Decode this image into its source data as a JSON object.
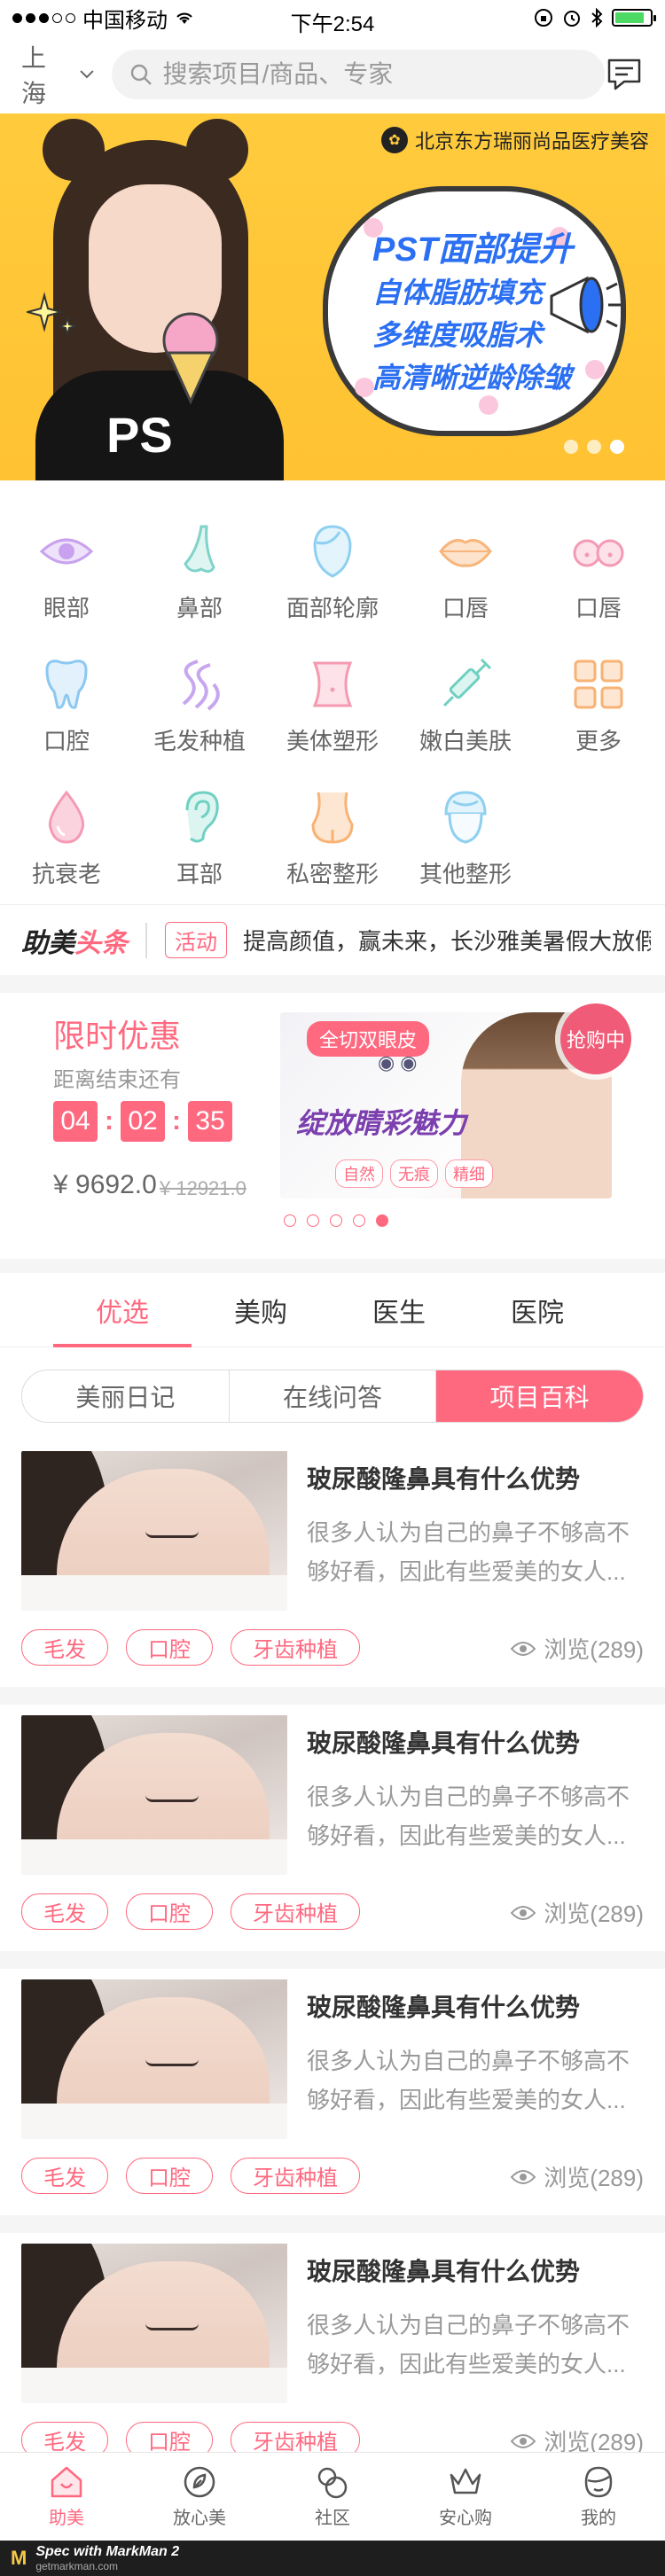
{
  "status": {
    "carrier": "中国移动",
    "time": "下午2:54"
  },
  "header": {
    "city": "上海",
    "search_placeholder": "搜索项目/商品、专家"
  },
  "banner": {
    "brand": "北京东方瑞丽尚品医疗美容",
    "lines": [
      "PST面部提升",
      "自体脂肪填充",
      "多维度吸脂术",
      "高清晰逆龄除皱"
    ],
    "shirt_text": "PS"
  },
  "categories": [
    {
      "label": "眼部",
      "icon": "eye-icon",
      "color": "#c9a2ef"
    },
    {
      "label": "鼻部",
      "icon": "nose-icon",
      "color": "#7fd3c8"
    },
    {
      "label": "面部轮廓",
      "icon": "face-contour-icon",
      "color": "#8fd0f0"
    },
    {
      "label": "口唇",
      "icon": "lips-icon",
      "color": "#f7b57a"
    },
    {
      "label": "口唇",
      "icon": "chest-icon",
      "color": "#f49ab5"
    },
    {
      "label": "口腔",
      "icon": "tooth-icon",
      "color": "#8cc8f2"
    },
    {
      "label": "毛发种植",
      "icon": "hair-icon",
      "color": "#c7a6ef"
    },
    {
      "label": "美体塑形",
      "icon": "body-shape-icon",
      "color": "#f59ab0"
    },
    {
      "label": "嫩白美肤",
      "icon": "syringe-icon",
      "color": "#6fd0c2"
    },
    {
      "label": "更多",
      "icon": "grid-more-icon",
      "color": "#f8b274"
    },
    {
      "label": "抗衰老",
      "icon": "drop-icon",
      "color": "#f49ab5"
    },
    {
      "label": "耳部",
      "icon": "ear-icon",
      "color": "#6fd0c2"
    },
    {
      "label": "私密整形",
      "icon": "hip-icon",
      "color": "#f8b274"
    },
    {
      "label": "其他整形",
      "icon": "towel-head-icon",
      "color": "#8fd0f0"
    }
  ],
  "news": {
    "title_a": "助美",
    "title_b": "头条",
    "tag": "活动",
    "text": "提高颜值，赢未来，长沙雅美暑假大放假大"
  },
  "flash": {
    "title": "限时优惠",
    "subtitle": "距离结束还有",
    "hours": "04",
    "minutes": "02",
    "seconds": "35",
    "price": "¥ 9692.0",
    "old_price": "¥ 12921.0",
    "buy_label": "抢购中",
    "promo_tag": "全切双眼皮",
    "promo_big": "绽放睛彩魅力",
    "promo_chips": [
      "自然",
      "无痕",
      "精细"
    ]
  },
  "main_tabs": [
    "优选",
    "美购",
    "医生",
    "医院"
  ],
  "segments": [
    "美丽日记",
    "在线问答",
    "项目百科"
  ],
  "articles": [
    {
      "title": "玻尿酸隆鼻具有什么优势",
      "desc": "很多人认为自己的鼻子不够高不够好看，因此有些爱美的女人...",
      "tags": [
        "毛发",
        "口腔",
        "牙齿种植"
      ],
      "views": "浏览(289)"
    },
    {
      "title": "玻尿酸隆鼻具有什么优势",
      "desc": "很多人认为自己的鼻子不够高不够好看，因此有些爱美的女人...",
      "tags": [
        "毛发",
        "口腔",
        "牙齿种植"
      ],
      "views": "浏览(289)"
    },
    {
      "title": "玻尿酸隆鼻具有什么优势",
      "desc": "很多人认为自己的鼻子不够高不够好看，因此有些爱美的女人...",
      "tags": [
        "毛发",
        "口腔",
        "牙齿种植"
      ],
      "views": "浏览(289)"
    },
    {
      "title": "玻尿酸隆鼻具有什么优势",
      "desc": "很多人认为自己的鼻子不够高不够好看，因此有些爱美的女人...",
      "tags": [
        "毛发",
        "口腔",
        "牙齿种植"
      ],
      "views": "浏览(289)"
    }
  ],
  "tabbar": [
    {
      "label": "助美",
      "icon": "home-icon"
    },
    {
      "label": "放心美",
      "icon": "shield-leaf-icon"
    },
    {
      "label": "社区",
      "icon": "community-icon"
    },
    {
      "label": "安心购",
      "icon": "crown-icon"
    },
    {
      "label": "我的",
      "icon": "profile-icon"
    }
  ],
  "footer": {
    "logo": "M",
    "line1": "Spec with MarkMan 2",
    "line2": "getmarkman.com"
  },
  "colors": {
    "accent": "#ff6980",
    "text": "#333333",
    "muted": "#999999"
  }
}
